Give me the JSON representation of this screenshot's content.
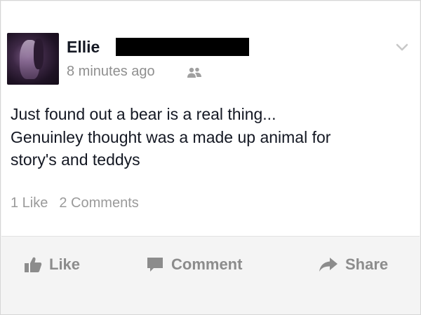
{
  "post": {
    "author": "Ellie",
    "timestamp": "8 minutes ago",
    "audience_icon": "friends-icon",
    "text_lines": [
      "Just found out a bear is a real thing...",
      "Genuinley thought was a made up animal for",
      "story's and teddys"
    ],
    "likes": "1 Like",
    "comments": "2 Comments"
  },
  "actions": {
    "like": "Like",
    "comment": "Comment",
    "share": "Share"
  },
  "colors": {
    "text": "#141823",
    "muted": "#8f8f8f",
    "redaction": "#000000"
  }
}
